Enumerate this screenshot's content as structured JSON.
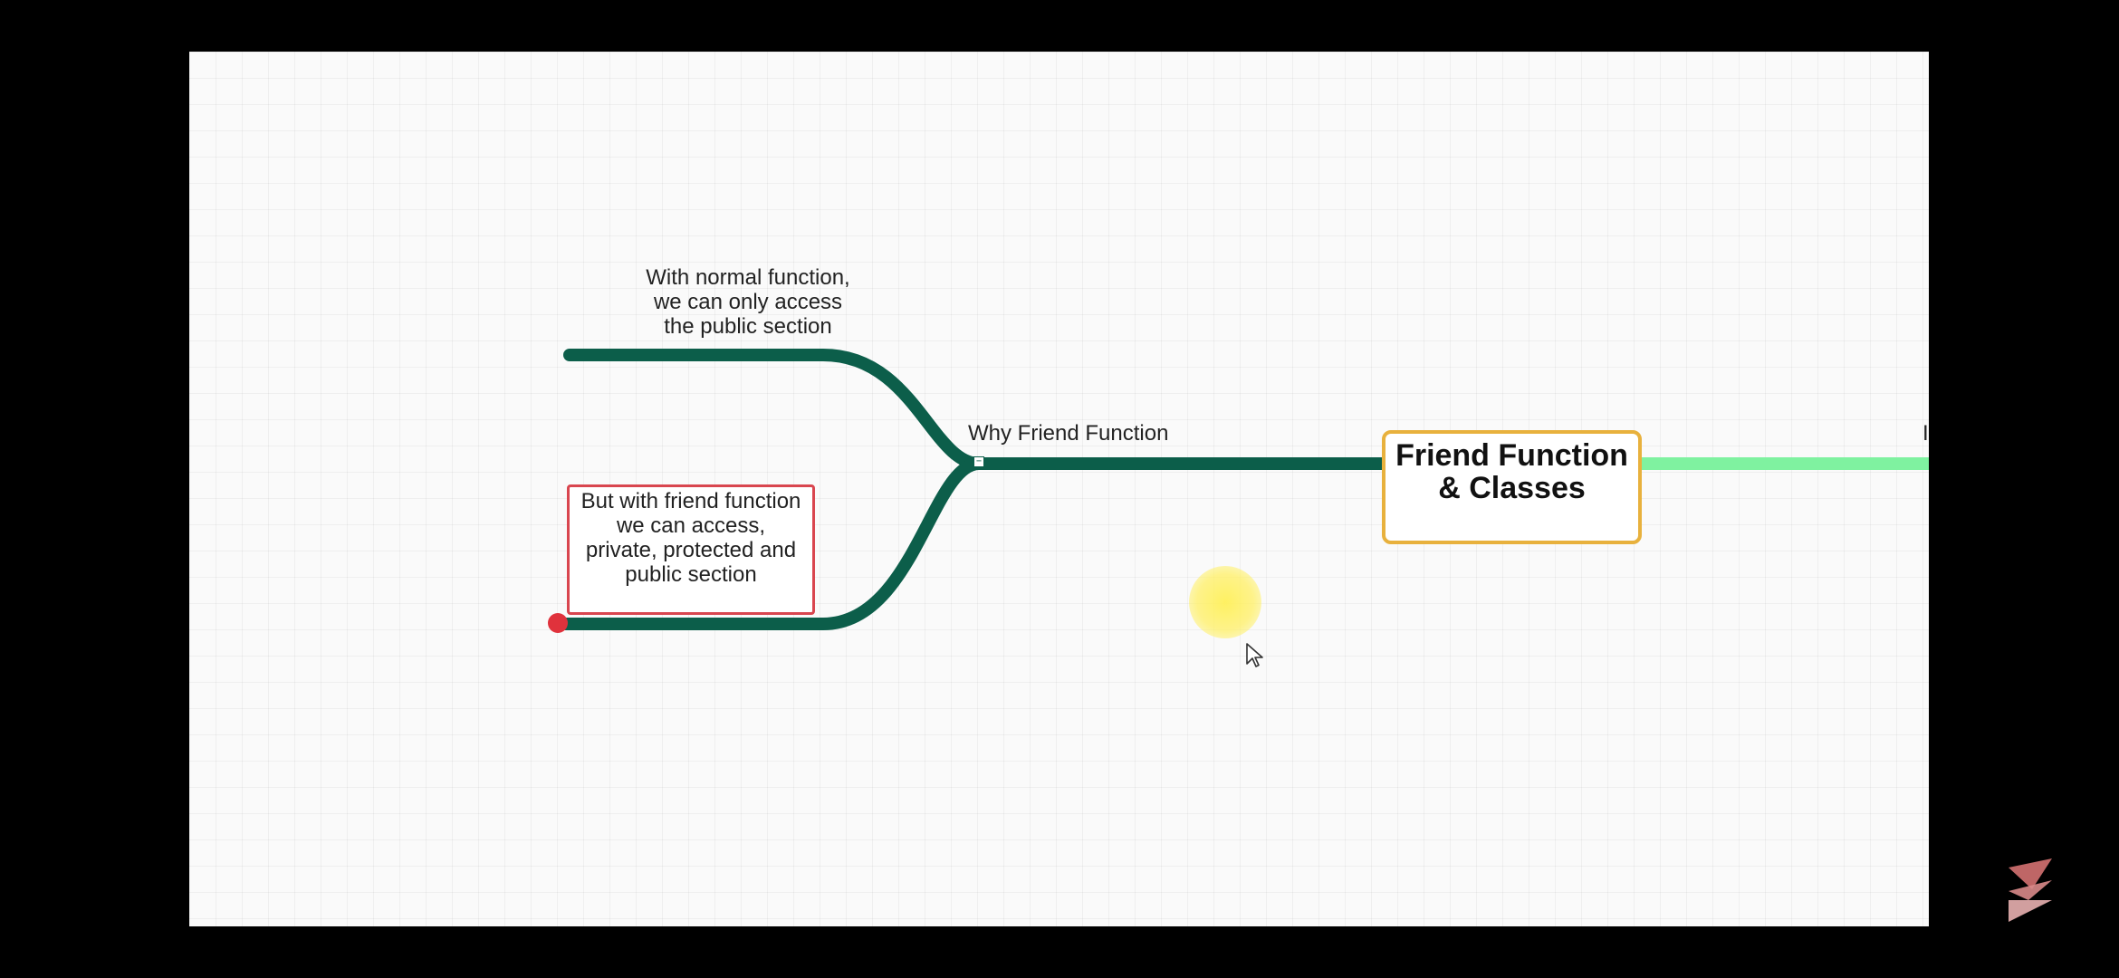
{
  "mindmap": {
    "central_topic": "Friend Function\n& Classes",
    "branch_label": "Why Friend Function",
    "subtopic_top": "With normal function,\nwe can only access\nthe public section",
    "subtopic_bottom": "But with friend function\nwe can access,\nprivate, protected and\npublic section",
    "collapse_symbol": "−",
    "right_edge_text": "I"
  },
  "colors": {
    "background": "#000000",
    "canvas": "#fafafa",
    "branch_dark_green": "#0c5e4a",
    "branch_light_green": "#7ff2a0",
    "central_border": "#e8b13d",
    "note_border": "#d9464f",
    "red_dot": "#e0323c",
    "cursor_highlight": "#fff05a"
  },
  "icons": {
    "cursor": "mouse-pointer-icon",
    "watermark": "play-logo-icon"
  }
}
